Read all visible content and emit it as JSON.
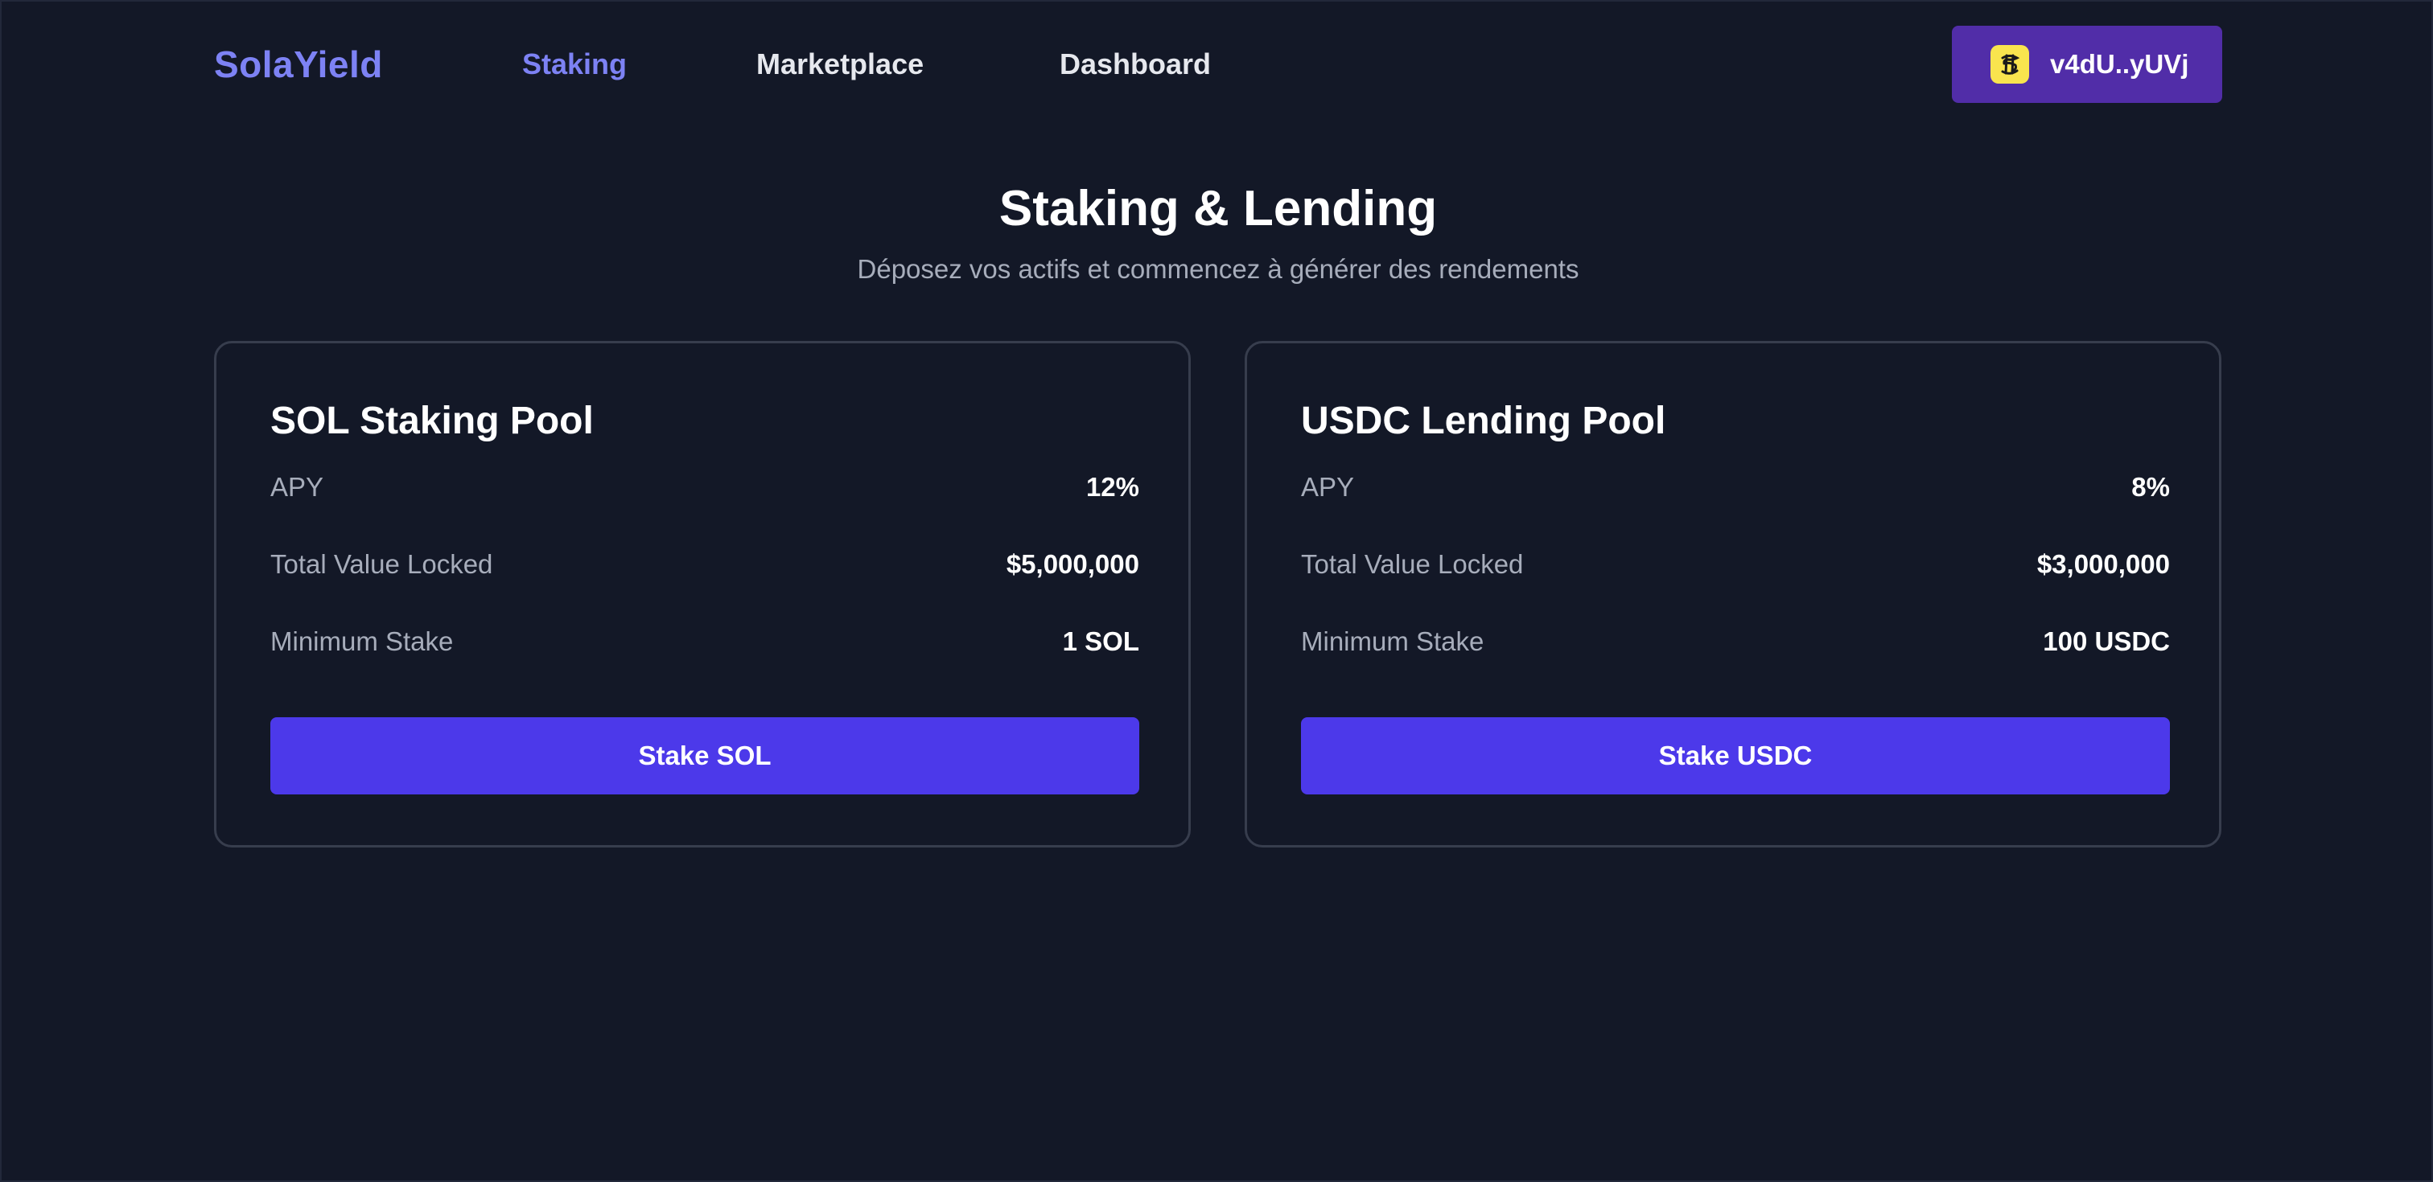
{
  "header": {
    "logo": "SolaYield",
    "nav": [
      {
        "label": "Staking",
        "active": true
      },
      {
        "label": "Marketplace",
        "active": false
      },
      {
        "label": "Dashboard",
        "active": false
      }
    ],
    "wallet": {
      "label": "v4dU..yUVj",
      "icon": "solana-wallet-icon"
    }
  },
  "hero": {
    "title": "Staking & Lending",
    "subtitle": "Déposez vos actifs et commencez à générer des rendements"
  },
  "pools": [
    {
      "title": "SOL Staking Pool",
      "rows": [
        {
          "label": "APY",
          "value": "12%"
        },
        {
          "label": "Total Value Locked",
          "value": "$5,000,000"
        },
        {
          "label": "Minimum Stake",
          "value": "1 SOL"
        }
      ],
      "button": "Stake SOL"
    },
    {
      "title": "USDC Lending Pool",
      "rows": [
        {
          "label": "APY",
          "value": "8%"
        },
        {
          "label": "Total Value Locked",
          "value": "$3,000,000"
        },
        {
          "label": "Minimum Stake",
          "value": "100 USDC"
        }
      ],
      "button": "Stake USDC"
    }
  ],
  "colors": {
    "background": "#131827",
    "accent": "#7d82f4",
    "button": "#4c39ea",
    "wallet": "#512da8",
    "wallet_icon_bg": "#f9e44e"
  }
}
